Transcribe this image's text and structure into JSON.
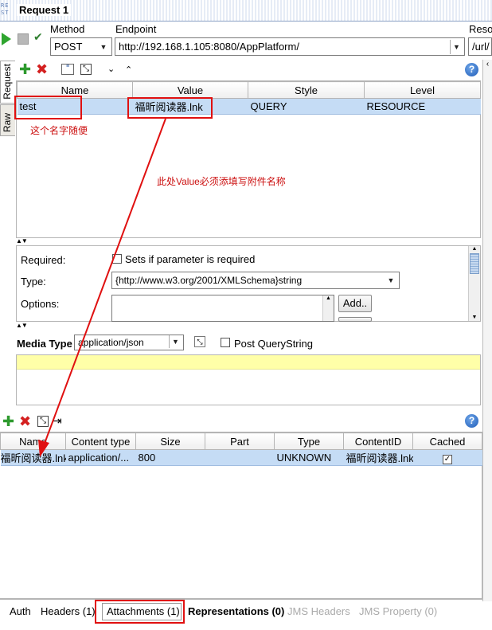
{
  "window": {
    "title": "Request 1",
    "rest_icon_text": "RE ST"
  },
  "request_bar": {
    "method_label": "Method",
    "method_value": "POST",
    "endpoint_label": "Endpoint",
    "endpoint_value": "http://192.168.1.105:8080/AppPlatform/",
    "resource_label": "Reso",
    "resource_value": "/url/"
  },
  "side_tabs": [
    "Request",
    "Raw"
  ],
  "params": {
    "columns": [
      "Name",
      "Value",
      "Style",
      "Level"
    ],
    "rows": [
      {
        "name": "test",
        "value": "福昕阅读器.lnk",
        "style": "QUERY",
        "level": "RESOURCE"
      }
    ],
    "annotation_name": "这个名字随便",
    "annotation_value": "此处Value必须添填写附件名称"
  },
  "details": {
    "required_label": "Required:",
    "required_text": "Sets if parameter is required",
    "type_label": "Type:",
    "type_value": "{http://www.w3.org/2001/XMLSchema}string",
    "options_label": "Options:",
    "add_button": "Add.."
  },
  "media": {
    "label": "Media Type",
    "value": "application/json",
    "post_querystring": "Post QueryString"
  },
  "attachments": {
    "columns": [
      "Name",
      "Content type",
      "Size",
      "Part",
      "Type",
      "ContentID",
      "Cached"
    ],
    "rows": [
      {
        "name": "福昕阅读器.lnk",
        "content_type": "application/...",
        "size": "800",
        "part": "",
        "type": "UNKNOWN",
        "content_id": "福昕阅读器.lnk",
        "cached": true
      }
    ]
  },
  "bottom_tabs": {
    "auth": "Auth",
    "headers": "Headers (1)",
    "attachments": "Attachments (1)",
    "representations": "Representations (0)",
    "jms_headers": "JMS Headers",
    "jms_property": "JMS Property (0)"
  },
  "colors": {
    "selected_row": "#c5dcf5",
    "annotation": "#cc1010",
    "yellow_editor": "#ffffa8"
  }
}
